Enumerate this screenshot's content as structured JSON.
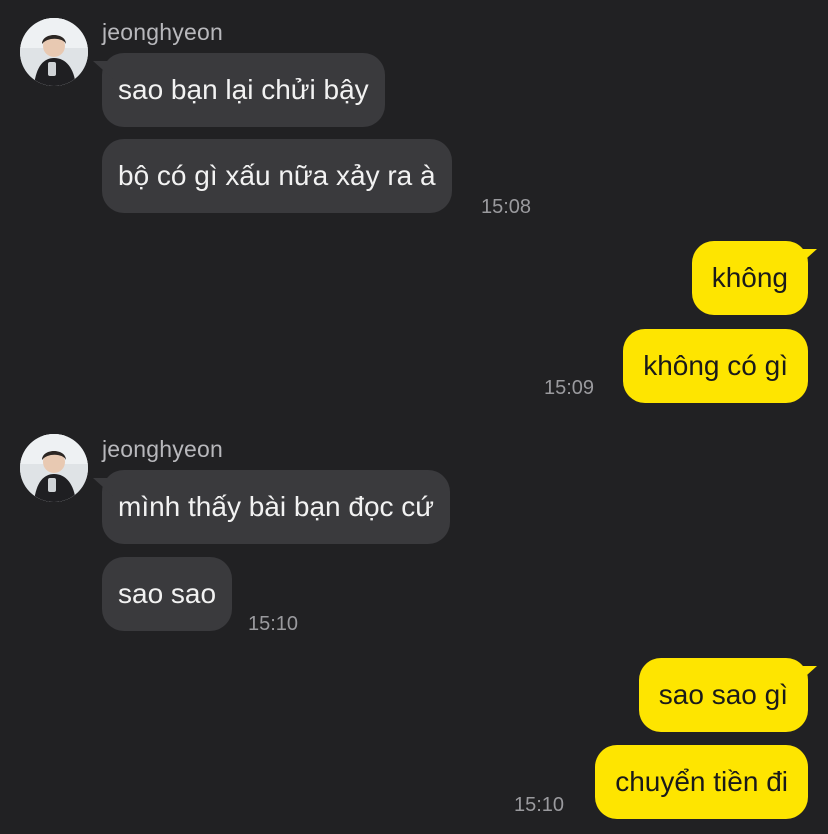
{
  "messages": {
    "group1": {
      "sender": "jeonghyeon",
      "bubbles": [
        "sao bạn lại chửi bậy",
        "bộ có gì xấu nữa xảy ra à"
      ],
      "time": "15:08"
    },
    "group2": {
      "bubbles": [
        "không",
        "không có gì"
      ],
      "time": "15:09"
    },
    "group3": {
      "sender": "jeonghyeon",
      "bubbles": [
        "mình thấy bài bạn đọc cứ",
        "sao sao"
      ],
      "time": "15:10"
    },
    "group4": {
      "bubbles": [
        "sao sao gì",
        "chuyển tiền đi"
      ],
      "time": "15:10"
    }
  },
  "colors": {
    "background": "#212123",
    "incoming_bubble": "#3a3a3d",
    "outgoing_bubble": "#fee500"
  },
  "icons": [
    "avatar-icon"
  ]
}
